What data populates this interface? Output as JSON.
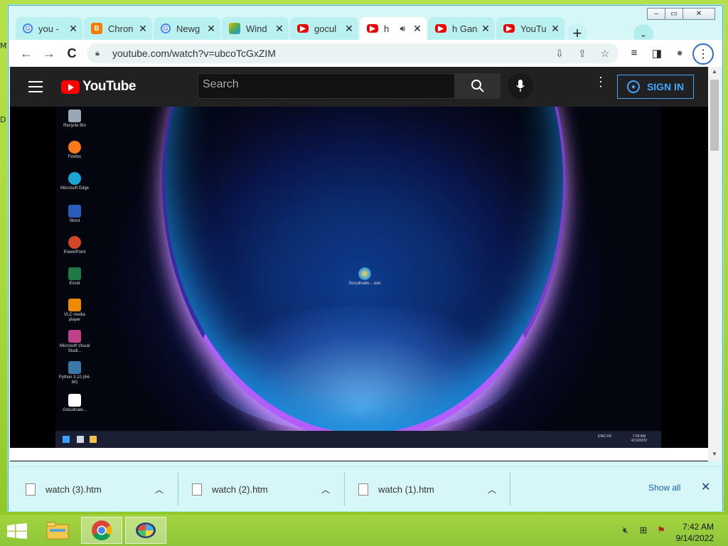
{
  "desktop": {
    "edge_letters": [
      "M",
      "D"
    ]
  },
  "window": {
    "controls": {
      "minimize": "–",
      "restore": "▭",
      "close": "✕"
    },
    "tabs": [
      {
        "label": "you -",
        "icon": "google-icon",
        "active": false
      },
      {
        "label": "Chron",
        "icon": "blogger-icon",
        "active": false
      },
      {
        "label": "Newg",
        "icon": "google-icon",
        "active": false
      },
      {
        "label": "Wind",
        "icon": "windows-app-icon",
        "active": false
      },
      {
        "label": "gocul",
        "icon": "youtube-icon",
        "active": false
      },
      {
        "label": "h",
        "icon": "youtube-icon",
        "active": true,
        "audio": true
      },
      {
        "label": "h Gan",
        "icon": "youtube-icon",
        "active": false
      },
      {
        "label": "YouTu",
        "icon": "youtube-icon",
        "active": false
      }
    ],
    "new_tab": "+",
    "tab_search": "⌄"
  },
  "toolbar": {
    "url": "youtube.com/watch?v=ubcoTcGxZIM",
    "back": "←",
    "forward": "→",
    "reload": "C",
    "menu": "⋮"
  },
  "youtube": {
    "logo_text": "YouTube",
    "search_placeholder": "Search",
    "sign_in": "SIGN IN",
    "more": "⋮"
  },
  "video": {
    "desktop_icons": [
      {
        "label": "Recycle Bin",
        "color": "#9aa7b5"
      },
      {
        "label": "Firefox",
        "color": "#ff7a1a"
      },
      {
        "label": "Microsoft Edge",
        "color": "#1aa5d6"
      },
      {
        "label": "Word",
        "color": "#2b5cb8"
      },
      {
        "label": "PowerPoint",
        "color": "#d24726"
      },
      {
        "label": "Excel",
        "color": "#1d7a45"
      },
      {
        "label": "VLC media player",
        "color": "#f08a00"
      },
      {
        "label": "Microsoft Visual Studi...",
        "color": "#c0408a"
      },
      {
        "label": "Python 3.10 (64-bit)",
        "color": "#3b77a8"
      },
      {
        "label": "Goculinate...",
        "color": "#ffffff"
      }
    ],
    "center_icon_label": "Goculinate... exe",
    "taskbar_clock": {
      "time": "7:24 AM",
      "date": "4/13/2022"
    },
    "lang": "ENG FR"
  },
  "downloads": {
    "items": [
      {
        "name": "watch (3).htm"
      },
      {
        "name": "watch (2).htm"
      },
      {
        "name": "watch (1).htm"
      }
    ],
    "show_all": "Show all",
    "close": "✕"
  },
  "taskbar": {
    "clock_time": "7:42 AM",
    "clock_date": "9/14/2022",
    "apps": [
      "file-explorer-icon",
      "chrome-icon",
      "goculinate-icon"
    ]
  }
}
